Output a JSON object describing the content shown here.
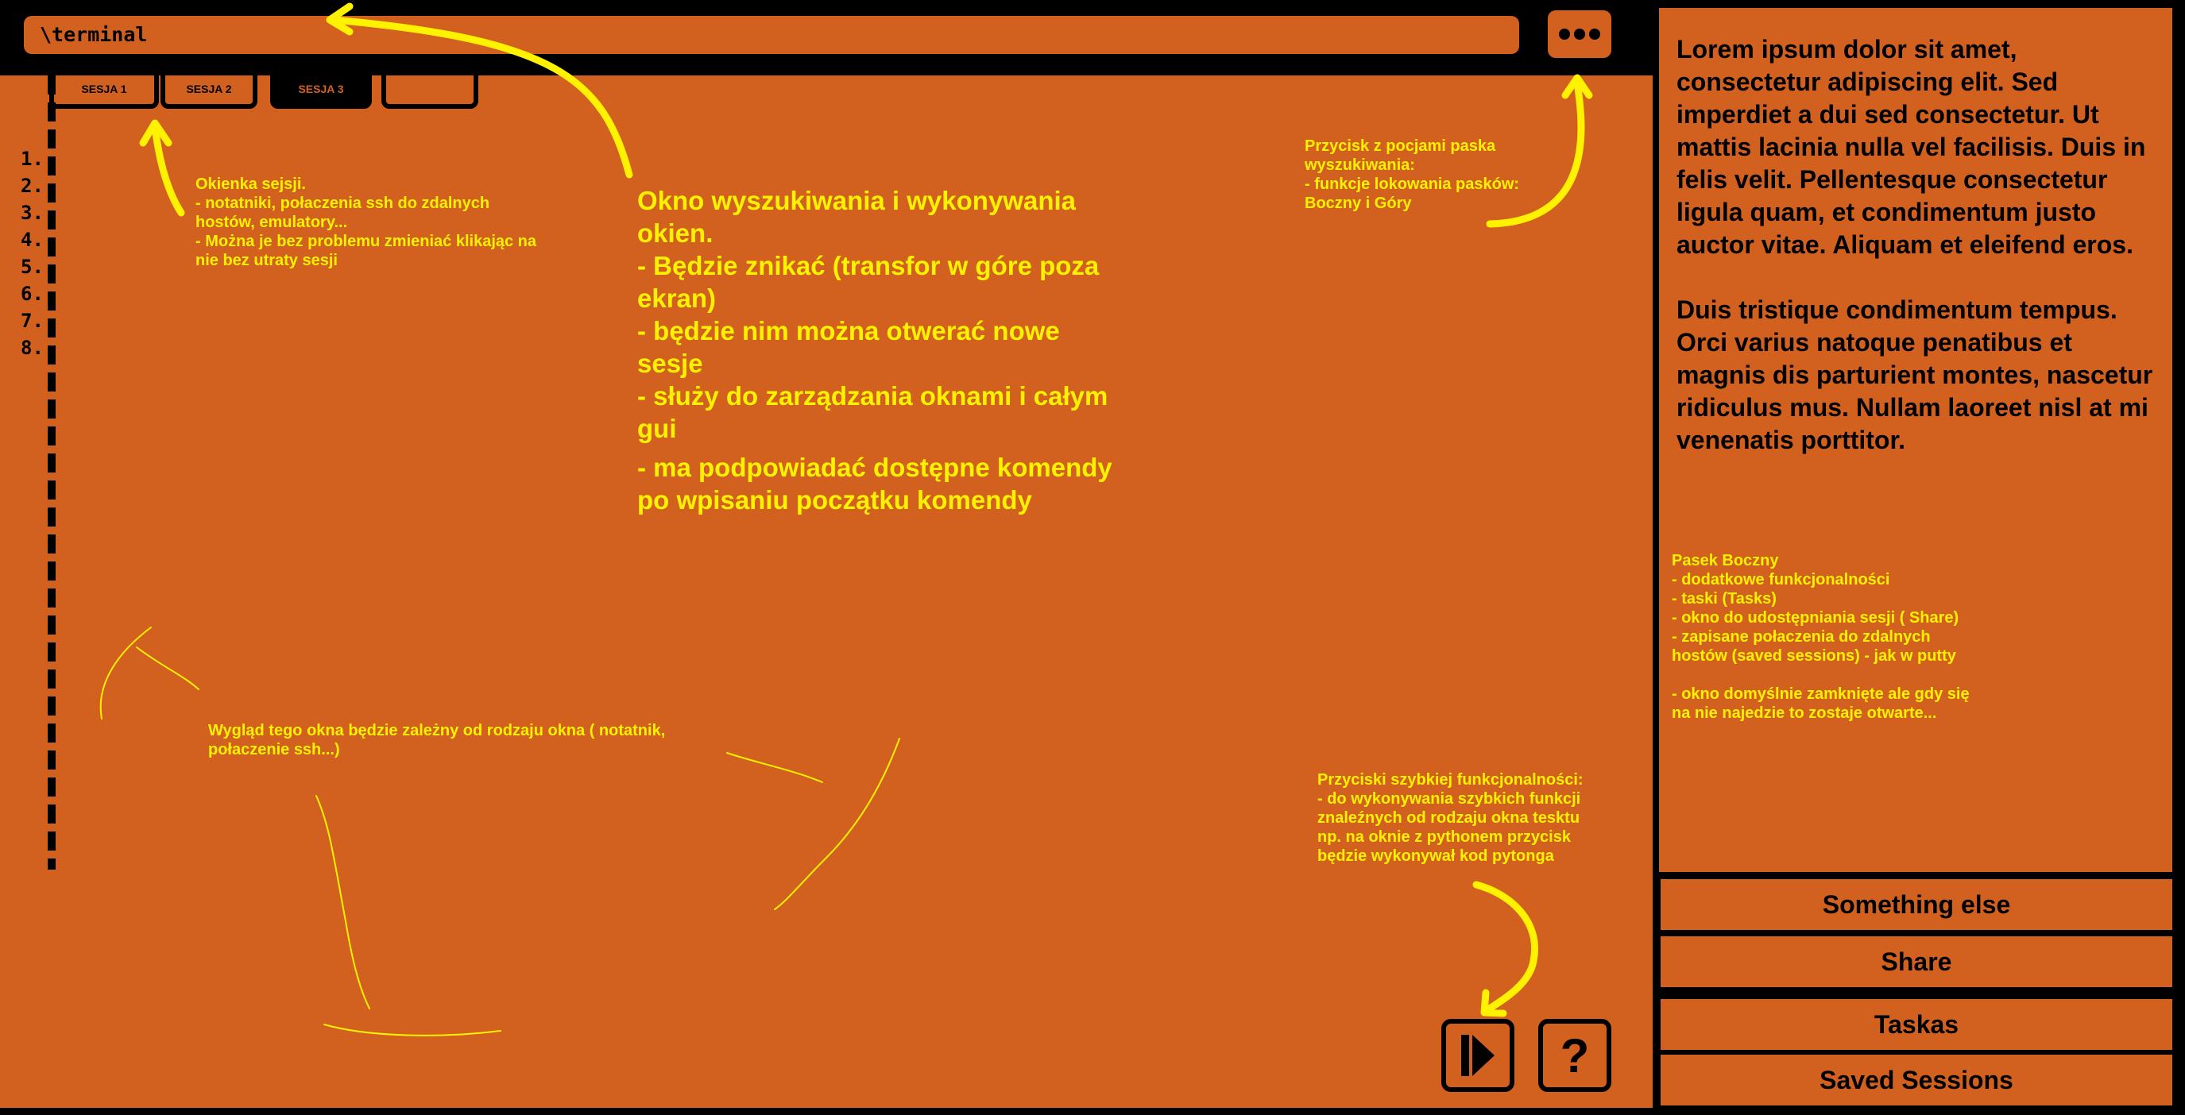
{
  "search": {
    "value": "\\terminal"
  },
  "menu_button": {
    "icon": "more-icon"
  },
  "tabs": [
    {
      "label": "SESJA 1",
      "active": false
    },
    {
      "label": "SESJA 2",
      "active": false
    },
    {
      "label": "SESJA 3",
      "active": true
    },
    {
      "label": "",
      "active": false
    }
  ],
  "line_numbers": [
    "1.",
    "2.",
    "3.",
    "4.",
    "5.",
    "6.",
    "7.",
    "8."
  ],
  "notes": {
    "sessions": "Okienka sejsji.\n- notatniki, połaczenia ssh do  zdalnych hostów, emulatory...\n- Można je bez problemu zmieniać klikając na nie bez utraty sesji",
    "search_window": "Okno wyszukiwania i wykonywania okien.\n- Będzie znikać (transfor w góre poza ekran)\n- będzie nim można otwerać nowe sesje\n- służy do zarządzania oknami i całym gui",
    "search_window_extra": "- ma podpowiadać dostępne komendy po wpisaniu początku komendy",
    "menu_button_note": "Przycisk z pocjami paska wyszukiwania:\n- funkcje lokowania pasków: Boczny i Góry",
    "window_look": "Wygląd tego okna będzie zależny od rodzaju okna ( notatnik, połaczenie ssh...)",
    "quick_buttons": "Przyciski szybkiej funkcjonalności:\n- do wykonywania szybkich funkcji znaleźnych od rodzaju okna tesktu np. na oknie z pythonem przycisk będzie wykonywał kod pytonga",
    "sidebar": "Pasek Boczny\n- dodatkowe funkcjonalności\n- taski (Tasks)\n- okno do udostępniania sesji ( Share)\n- zapisane połaczenia do zdalnych hostów (saved sessions) - jak w putty\n\n- okno domyślnie zamknięte ale gdy się na nie najedzie to zostaje otwarte..."
  },
  "sidebar": {
    "lorem_p1": "Lorem ipsum dolor sit amet, consectetur adipiscing elit. Sed imperdiet a dui sed consectetur. Ut mattis lacinia nulla vel facilisis. Duis in felis velit. Pellentesque consectetur ligula quam, et condimentum justo auctor vitae. Aliquam et eleifend eros.",
    "lorem_p2": "Duis tristique condimentum tempus. Orci varius natoque penatibus et magnis dis parturient montes, nascetur ridiculus mus. Nullam laoreet nisl at mi venenatis porttitor.",
    "buttons": [
      "Something else",
      "Share",
      "Taskas",
      "Saved Sessions"
    ]
  },
  "quick_buttons": {
    "run": "play-icon",
    "help": "?"
  },
  "colors": {
    "background": "#D2601F",
    "annotation": "#FFF200",
    "frame": "#000000"
  }
}
